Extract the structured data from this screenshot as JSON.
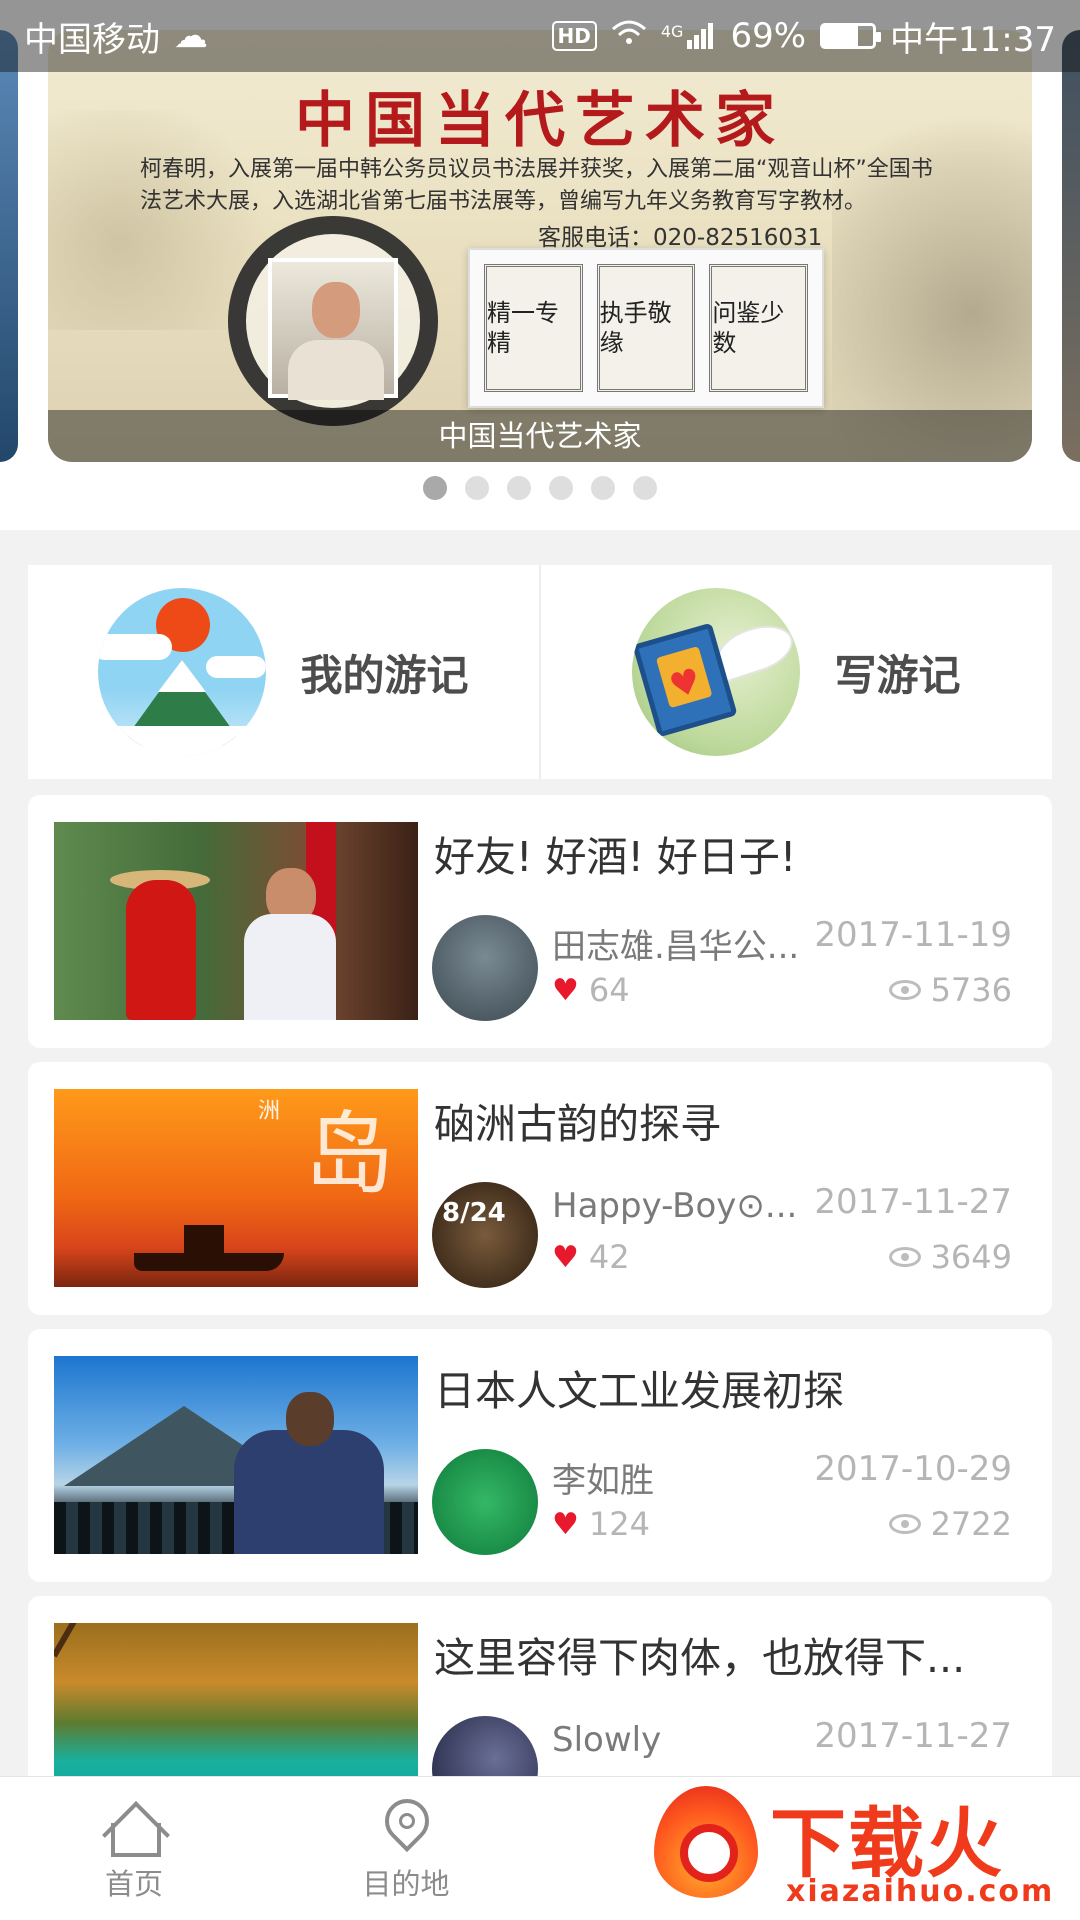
{
  "status_bar": {
    "carrier": "中国移动",
    "network": "HD",
    "signal": "4G",
    "battery": "69%",
    "battery_level": 0.69,
    "time": "中午11:37"
  },
  "banner": {
    "title": "中国当代艺术家",
    "description": "柯春明，入展第一届中韩公务员议员书法展并获奖，入展第二届“观音山杯”全国书法艺术大展，入选湖北省第七届书法展等，曾编写九年义务教育写字教材。",
    "phone": "客服电话：020-82516031",
    "scrolls": [
      "精一专精",
      "执手敬缘",
      "问鉴少数"
    ],
    "caption": "中国当代艺术家",
    "page_count": 6,
    "active_page": 0
  },
  "features": [
    {
      "label": "我的游记",
      "icon": "mountain-sun-icon"
    },
    {
      "label": "写游记",
      "icon": "book-heart-icon"
    }
  ],
  "posts": [
    {
      "title": "好友! 好酒! 好日子!",
      "author": "田志雄.昌华公...",
      "date": "2017-11-19",
      "likes": "64",
      "views": "5736"
    },
    {
      "title": "硇洲古韵的探寻",
      "author": "Happy-Boy⊙...",
      "date": "2017-11-27",
      "likes": "42",
      "views": "3649",
      "thumb_chars": [
        "洲",
        "岛"
      ],
      "avatar_text": "8/24"
    },
    {
      "title": "日本人文工业发展初探",
      "author": "李如胜",
      "date": "2017-10-29",
      "likes": "124",
      "views": "2722"
    },
    {
      "title": "这里容得下肉体，也放得下...",
      "author": "Slowly",
      "date": "2017-11-27",
      "likes": "",
      "views": ""
    }
  ],
  "bottom_nav": {
    "items": [
      {
        "label": "首页",
        "icon": "home-icon"
      },
      {
        "label": "目的地",
        "icon": "location-pin-icon"
      }
    ]
  },
  "watermark": {
    "text": "下载火",
    "url": "xiazaihuo.com"
  },
  "colors": {
    "accent_red": "#e8182d",
    "banner_title_red": "#b4191c",
    "watermark_orange": "#ef3b1b",
    "background": "#f2f2f2"
  }
}
